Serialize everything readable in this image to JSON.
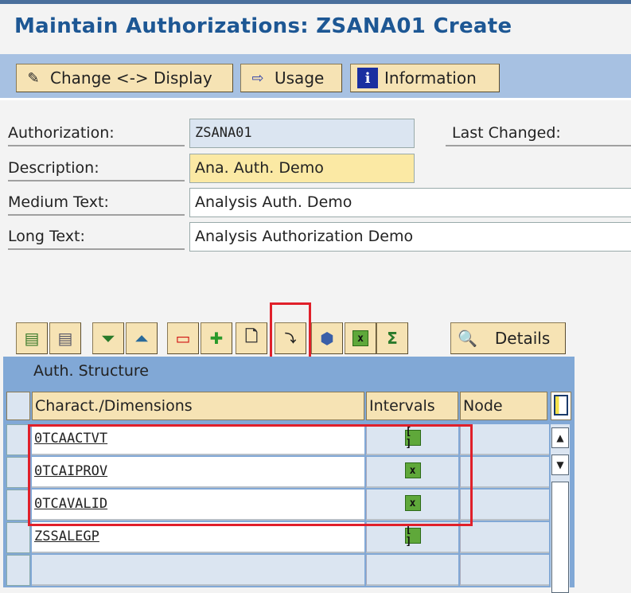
{
  "title": "Maintain Authorizations: ZSANA01 Create",
  "toolbar": {
    "change_display": "Change <-> Display",
    "usage": "Usage",
    "information": "Information"
  },
  "form": {
    "authorization_label": "Authorization:",
    "authorization_value": "ZSANA01",
    "last_changed_label": "Last Changed:",
    "description_label": "Description:",
    "description_value": "Ana. Auth. Demo",
    "medium_label": "Medium Text:",
    "medium_value": "Analysis Auth. Demo",
    "long_label": "Long Text:",
    "long_value": "Analysis Authorization Demo"
  },
  "grid_toolbar": {
    "details": "Details"
  },
  "table": {
    "title": "Auth. Structure",
    "columns": [
      "Charact./Dimensions",
      "Intervals",
      "Node"
    ],
    "rows": [
      {
        "name": "0TCAACTVT",
        "interval": "[ ]"
      },
      {
        "name": "0TCAIPROV",
        "interval": "x"
      },
      {
        "name": "0TCAVALID",
        "interval": "x"
      },
      {
        "name": "ZSSALEGP",
        "interval": "[ ]"
      }
    ]
  },
  "colors": {
    "title": "#1d5794",
    "toolbar_band": "#a7c1e2",
    "button": "#f6e3b4",
    "panel": "#81a8d6",
    "highlight": "#e0202a"
  }
}
